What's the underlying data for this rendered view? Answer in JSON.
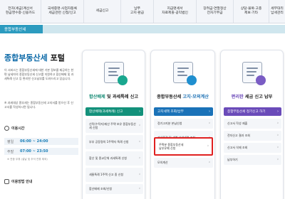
{
  "topnav": {
    "items": [
      "전자(세금)계산서\n현금영수증·신용카드",
      "국세증명·사업자등록\n세금관련 신청/신고",
      "세금신고",
      "납부\n고지·환급",
      "지급명세서\n자료제출·공익법인",
      "장려금·연말정산\n전자기부금",
      "상담·불복·고충\n제보·기타",
      "세무대리\n납세관리"
    ]
  },
  "section": {
    "tab": "종합부동산세"
  },
  "sidebar": {
    "title_main": "종합부동산세",
    "title_tail": "포털",
    "intro": "이 서비스는 종합부동산세에 대한 기본 정보를 제공하는 한편 납세자의 종합부동산세 신고를 지원하고 합산배제 및 과세특례 신고 등 편리한 신고납부를 도와드리고 있습니다.",
    "note": "※ 과세대상 종부세는 종합부동산세 고지서를 받으신 후 신고서를 작성하시면 됩니다.",
    "hours_title": "이용시간",
    "hours": [
      {
        "label": "평일",
        "time": "06:00 ~ 24:00"
      },
      {
        "label": "주말",
        "time": "07:00 ~ 23:50"
      }
    ],
    "hours_note": "※ 연중 무휴 (설날 및 추석 연휴 제외)",
    "guide_title": "이용방법 안내"
  },
  "cards": [
    {
      "title_highlight": "합산배제",
      "title_rest": " 및 과세특례 신고",
      "head": "합산배제(과세특례) 신고",
      "items": [
        "신탁(수탁자)재산 주택 보유 종합부동산세 신청",
        "부부 공동명의 1주택자 특례 신청",
        "합산 및 종교단체 과세특례 신청",
        "세율특례 1주택 신고 중 신청",
        "합산배제 조회/신청"
      ]
    },
    {
      "title_pre": "종합부동산세 ",
      "title_highlight": "고지·모의계산",
      "head": "고지세액 조회/납부",
      "items": [
        "정기고지분 본납신청",
        "과세물건 및 세액 상세내역 조회",
        "주택분 종합부동산세\n납부유예 신청",
        "모의계산"
      ],
      "selected_index": 2
    },
    {
      "title_highlight": "편리한",
      "title_rest": " 세금 신고 납부",
      "head": "종합부동산세 정기신고 하기",
      "items": [
        "신고서 작성 제출",
        "전자신고 결과 조회",
        "신고서 삭제 조회",
        "납부하기"
      ]
    }
  ]
}
